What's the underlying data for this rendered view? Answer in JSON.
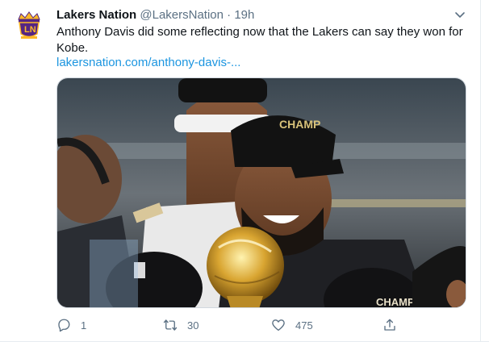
{
  "tweet": {
    "display_name": "Lakers Nation",
    "handle": "@LakersNation",
    "separator": "·",
    "time": "19h",
    "text": "Anthony Davis did some reflecting now that the Lakers can say they won for Kobe.",
    "link": "lakersnation.com/anthony-davis-..."
  },
  "media": {
    "hat_text_left": "CHAMP",
    "hat_text_right": "CHAMPION"
  },
  "actions": {
    "reply_count": "1",
    "retweet_count": "30",
    "like_count": "475",
    "share_count": ""
  },
  "colors": {
    "link": "#1b95e0",
    "muted": "#5b7083",
    "logo_purple": "#552583",
    "logo_gold": "#fdb927"
  },
  "icons": {
    "avatar": "lakers-nation-logo",
    "menu": "chevron-down-icon",
    "reply": "reply-icon",
    "retweet": "retweet-icon",
    "like": "heart-icon",
    "share": "share-icon"
  }
}
